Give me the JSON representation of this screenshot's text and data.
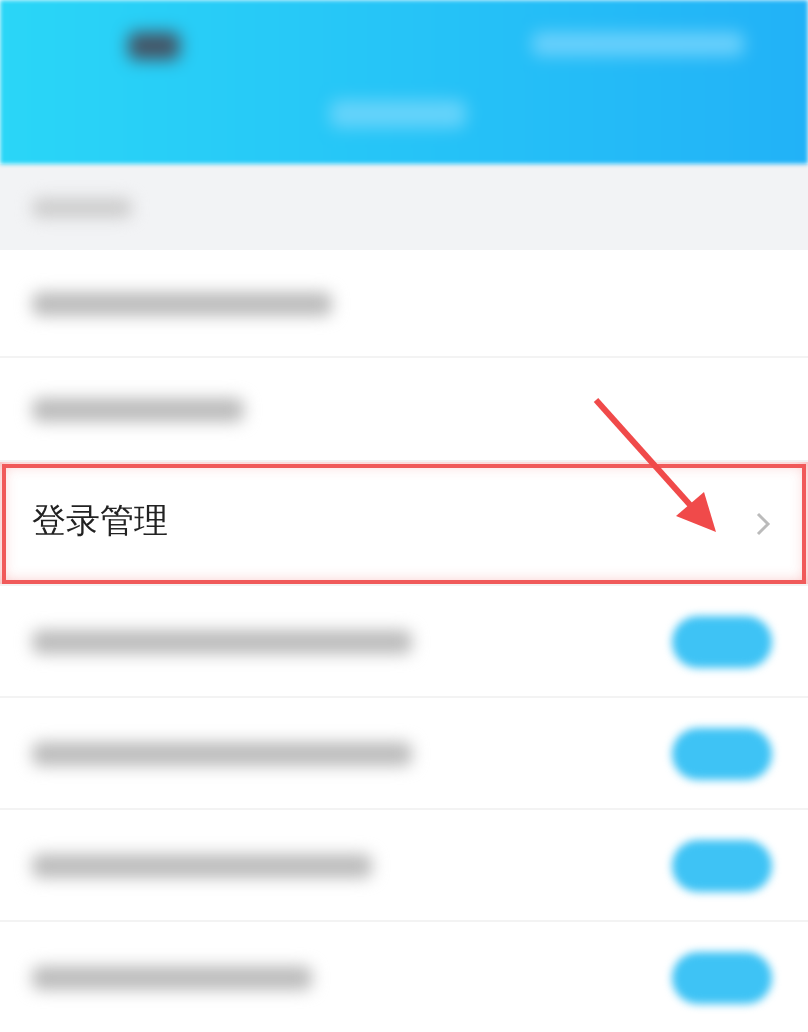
{
  "items": [
    {
      "kind": "plain"
    },
    {
      "kind": "plain"
    },
    {
      "kind": "link",
      "label": "登录管理",
      "highlighted": true
    },
    {
      "kind": "toggle",
      "on": true
    },
    {
      "kind": "toggle",
      "on": true
    },
    {
      "kind": "toggle",
      "on": true
    },
    {
      "kind": "toggle",
      "on": true
    }
  ]
}
